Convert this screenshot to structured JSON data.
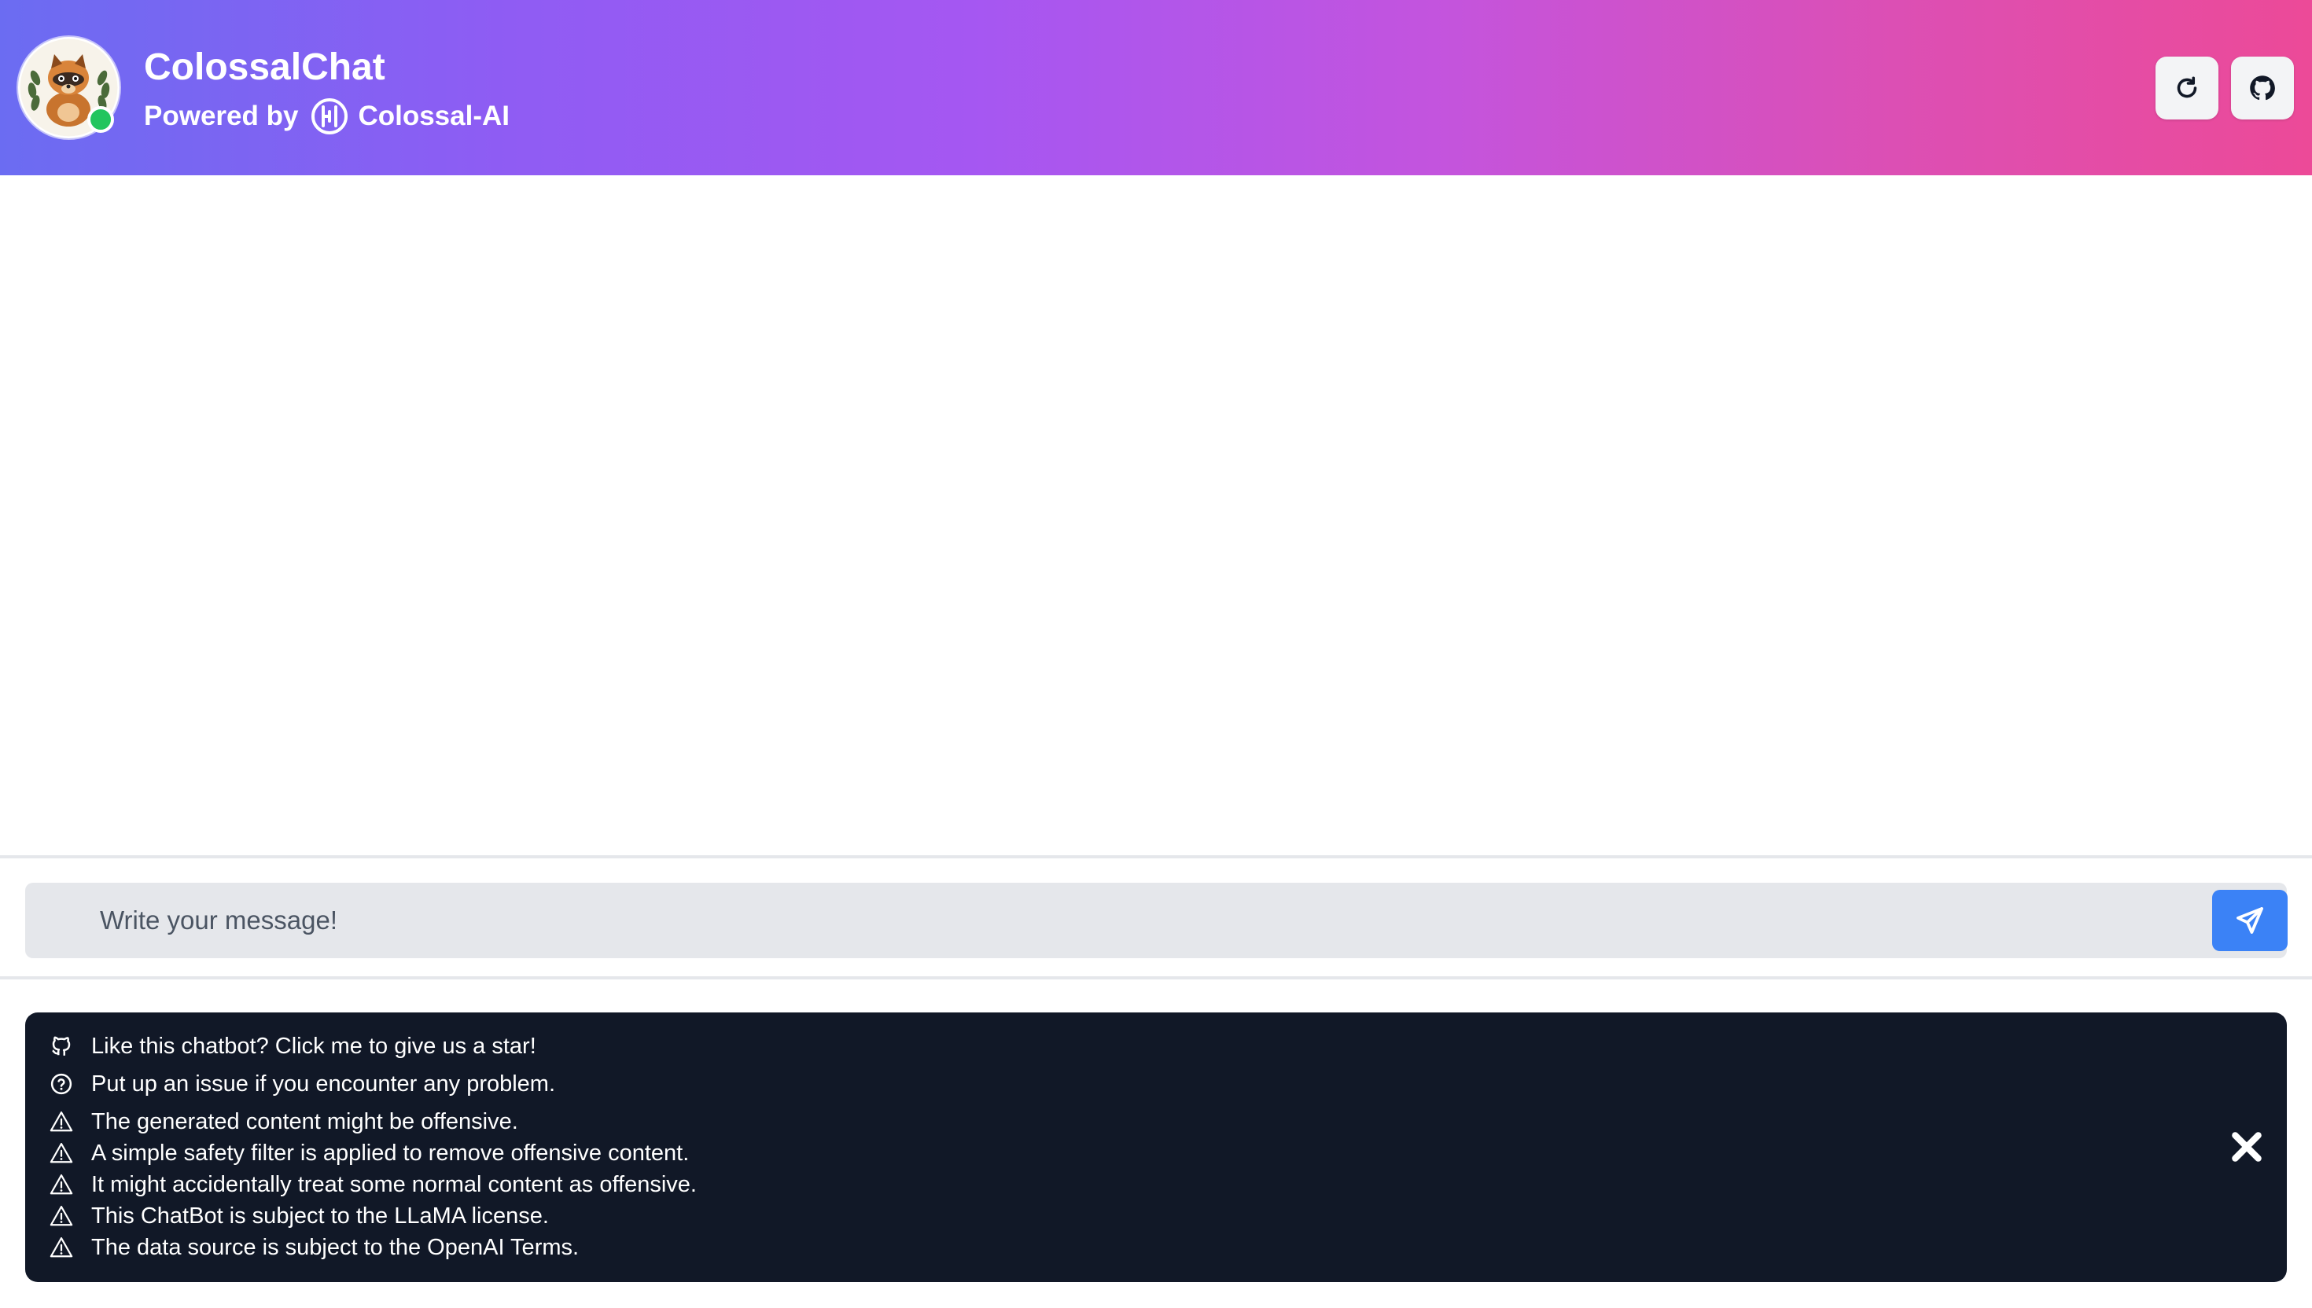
{
  "header": {
    "title": "ColossalChat",
    "powered_by": "Powered by",
    "brand": "Colossal-AI",
    "avatar_icon": "raccoon-mascot-icon",
    "status": "online",
    "refresh_icon": "refresh-icon",
    "github_icon": "github-icon"
  },
  "composer": {
    "placeholder": "Write your message!",
    "send_icon": "send-icon"
  },
  "notice": {
    "items": [
      {
        "icon": "github-icon",
        "text": "Like this chatbot? Click me to give us a star!"
      },
      {
        "icon": "question-icon",
        "text": "Put up an issue if you encounter any problem."
      },
      {
        "icon": "warning-icon",
        "text": "The generated content might be offensive."
      },
      {
        "icon": "warning-icon",
        "text": "A simple safety filter is applied to remove offensive content."
      },
      {
        "icon": "warning-icon",
        "text": "It might accidentally treat some normal content as offensive."
      },
      {
        "icon": "warning-icon",
        "text": "This ChatBot is subject to the LLaMA license."
      },
      {
        "icon": "warning-icon",
        "text": "The data source is subject to the OpenAI Terms."
      }
    ],
    "close_icon": "close-icon"
  },
  "colors": {
    "header_gradient_start": "#6b6cf2",
    "header_gradient_end": "#ec4a98",
    "send_button": "#3b82f6",
    "notice_background": "#111827",
    "status_online": "#22c55e"
  }
}
